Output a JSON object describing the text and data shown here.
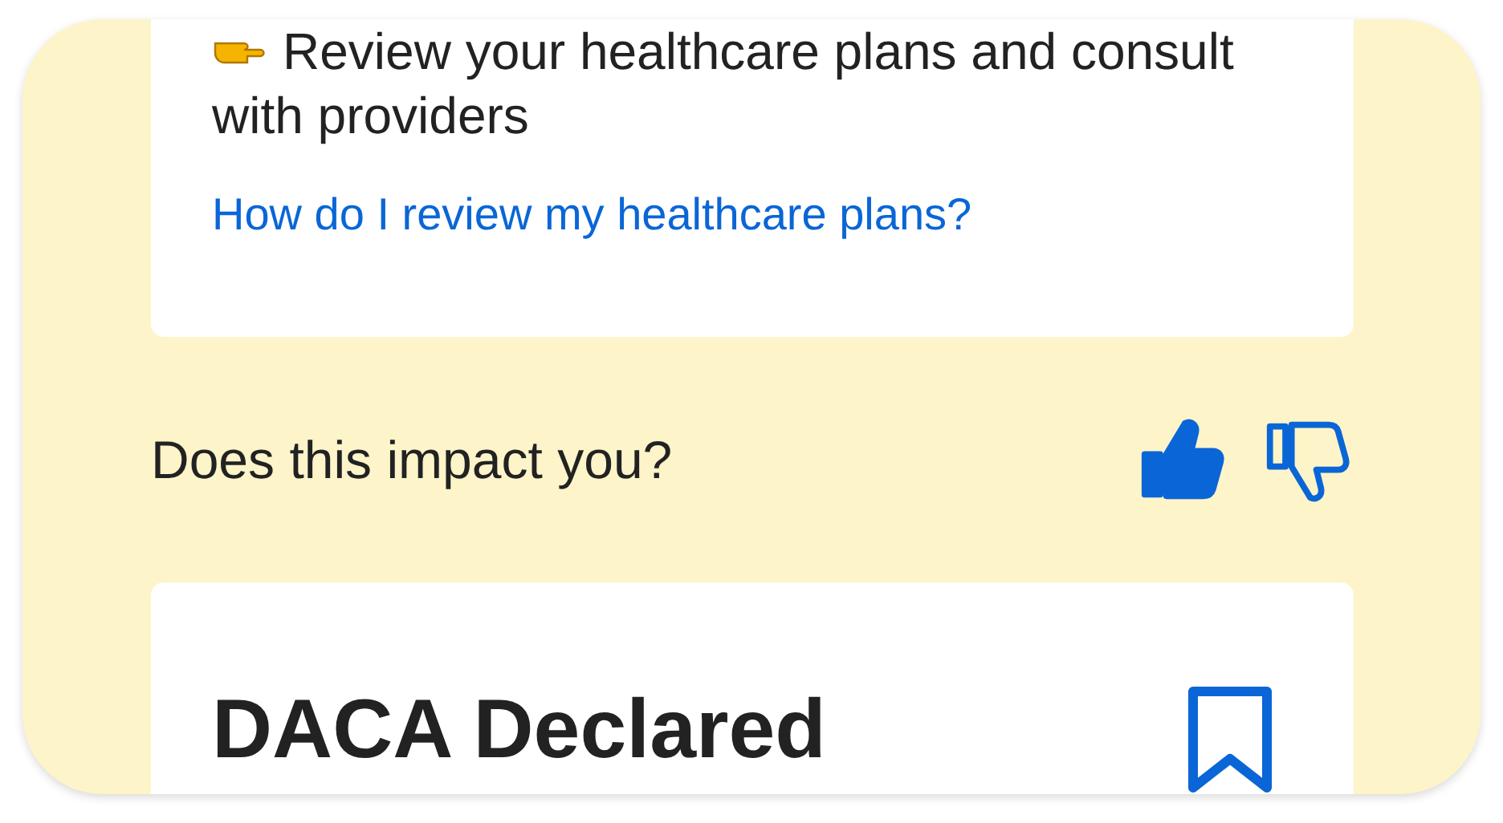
{
  "action_card": {
    "step": "Review your healthcare plans and consult with providers",
    "link": "How do I review my healthcare plans?"
  },
  "feedback": {
    "question": "Does this impact you?",
    "options": [
      {
        "kind": "up",
        "selected": true
      },
      {
        "kind": "down",
        "selected": false
      }
    ]
  },
  "news_card": {
    "title": "DACA Declared",
    "bookmarked": false
  }
}
